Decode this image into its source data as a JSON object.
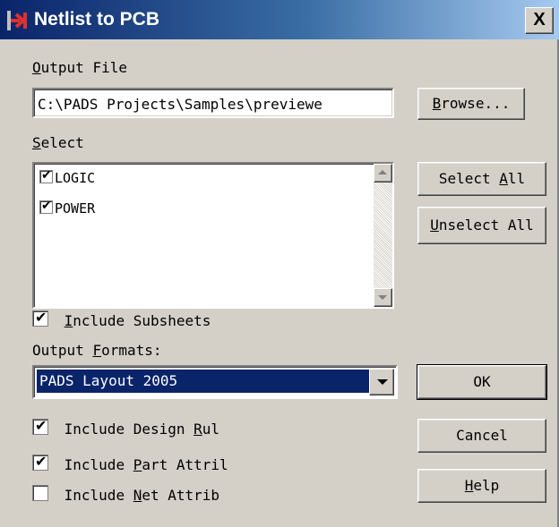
{
  "window": {
    "title": "Netlist to PCB",
    "close_label": "X"
  },
  "output_file": {
    "label_prefix": "",
    "label_access": "O",
    "label_rest": "utput File",
    "value": "C:\\PADS Projects\\Samples\\previewe"
  },
  "browse": {
    "access": "B",
    "rest": "rowse..."
  },
  "select": {
    "label_access": "S",
    "label_rest": "elect",
    "items": [
      {
        "label": "LOGIC",
        "checked": true
      },
      {
        "label": "POWER",
        "checked": true
      }
    ]
  },
  "select_all": {
    "prefix": "Select ",
    "access": "A",
    "rest": "ll"
  },
  "unselect_all": {
    "access": "U",
    "rest": "nselect All"
  },
  "include_subsheets": {
    "access": "I",
    "rest": "nclude Subsheets",
    "checked": true
  },
  "output_formats": {
    "label_prefix": "Output ",
    "label_access": "F",
    "label_rest": "ormats:",
    "selected": "PADS Layout 2005"
  },
  "ok": {
    "label": "OK"
  },
  "cancel": {
    "label": "Cancel"
  },
  "help": {
    "access": "H",
    "rest": "elp"
  },
  "options": [
    {
      "prefix": "Include Design ",
      "access": "R",
      "rest": "ul",
      "checked": true
    },
    {
      "prefix": "Include ",
      "access": "P",
      "rest": "art Attril",
      "checked": true
    },
    {
      "prefix": "Include ",
      "access": "N",
      "rest": "et Attrib",
      "checked": false
    }
  ],
  "colors": {
    "titlebar_start": "#0a246a",
    "titlebar_end": "#a6caf0",
    "face": "#d4d0c8",
    "selection": "#0a246a"
  },
  "icons": {
    "app": "netlist-app-icon",
    "close": "close-icon",
    "check": "checkmark-icon"
  }
}
